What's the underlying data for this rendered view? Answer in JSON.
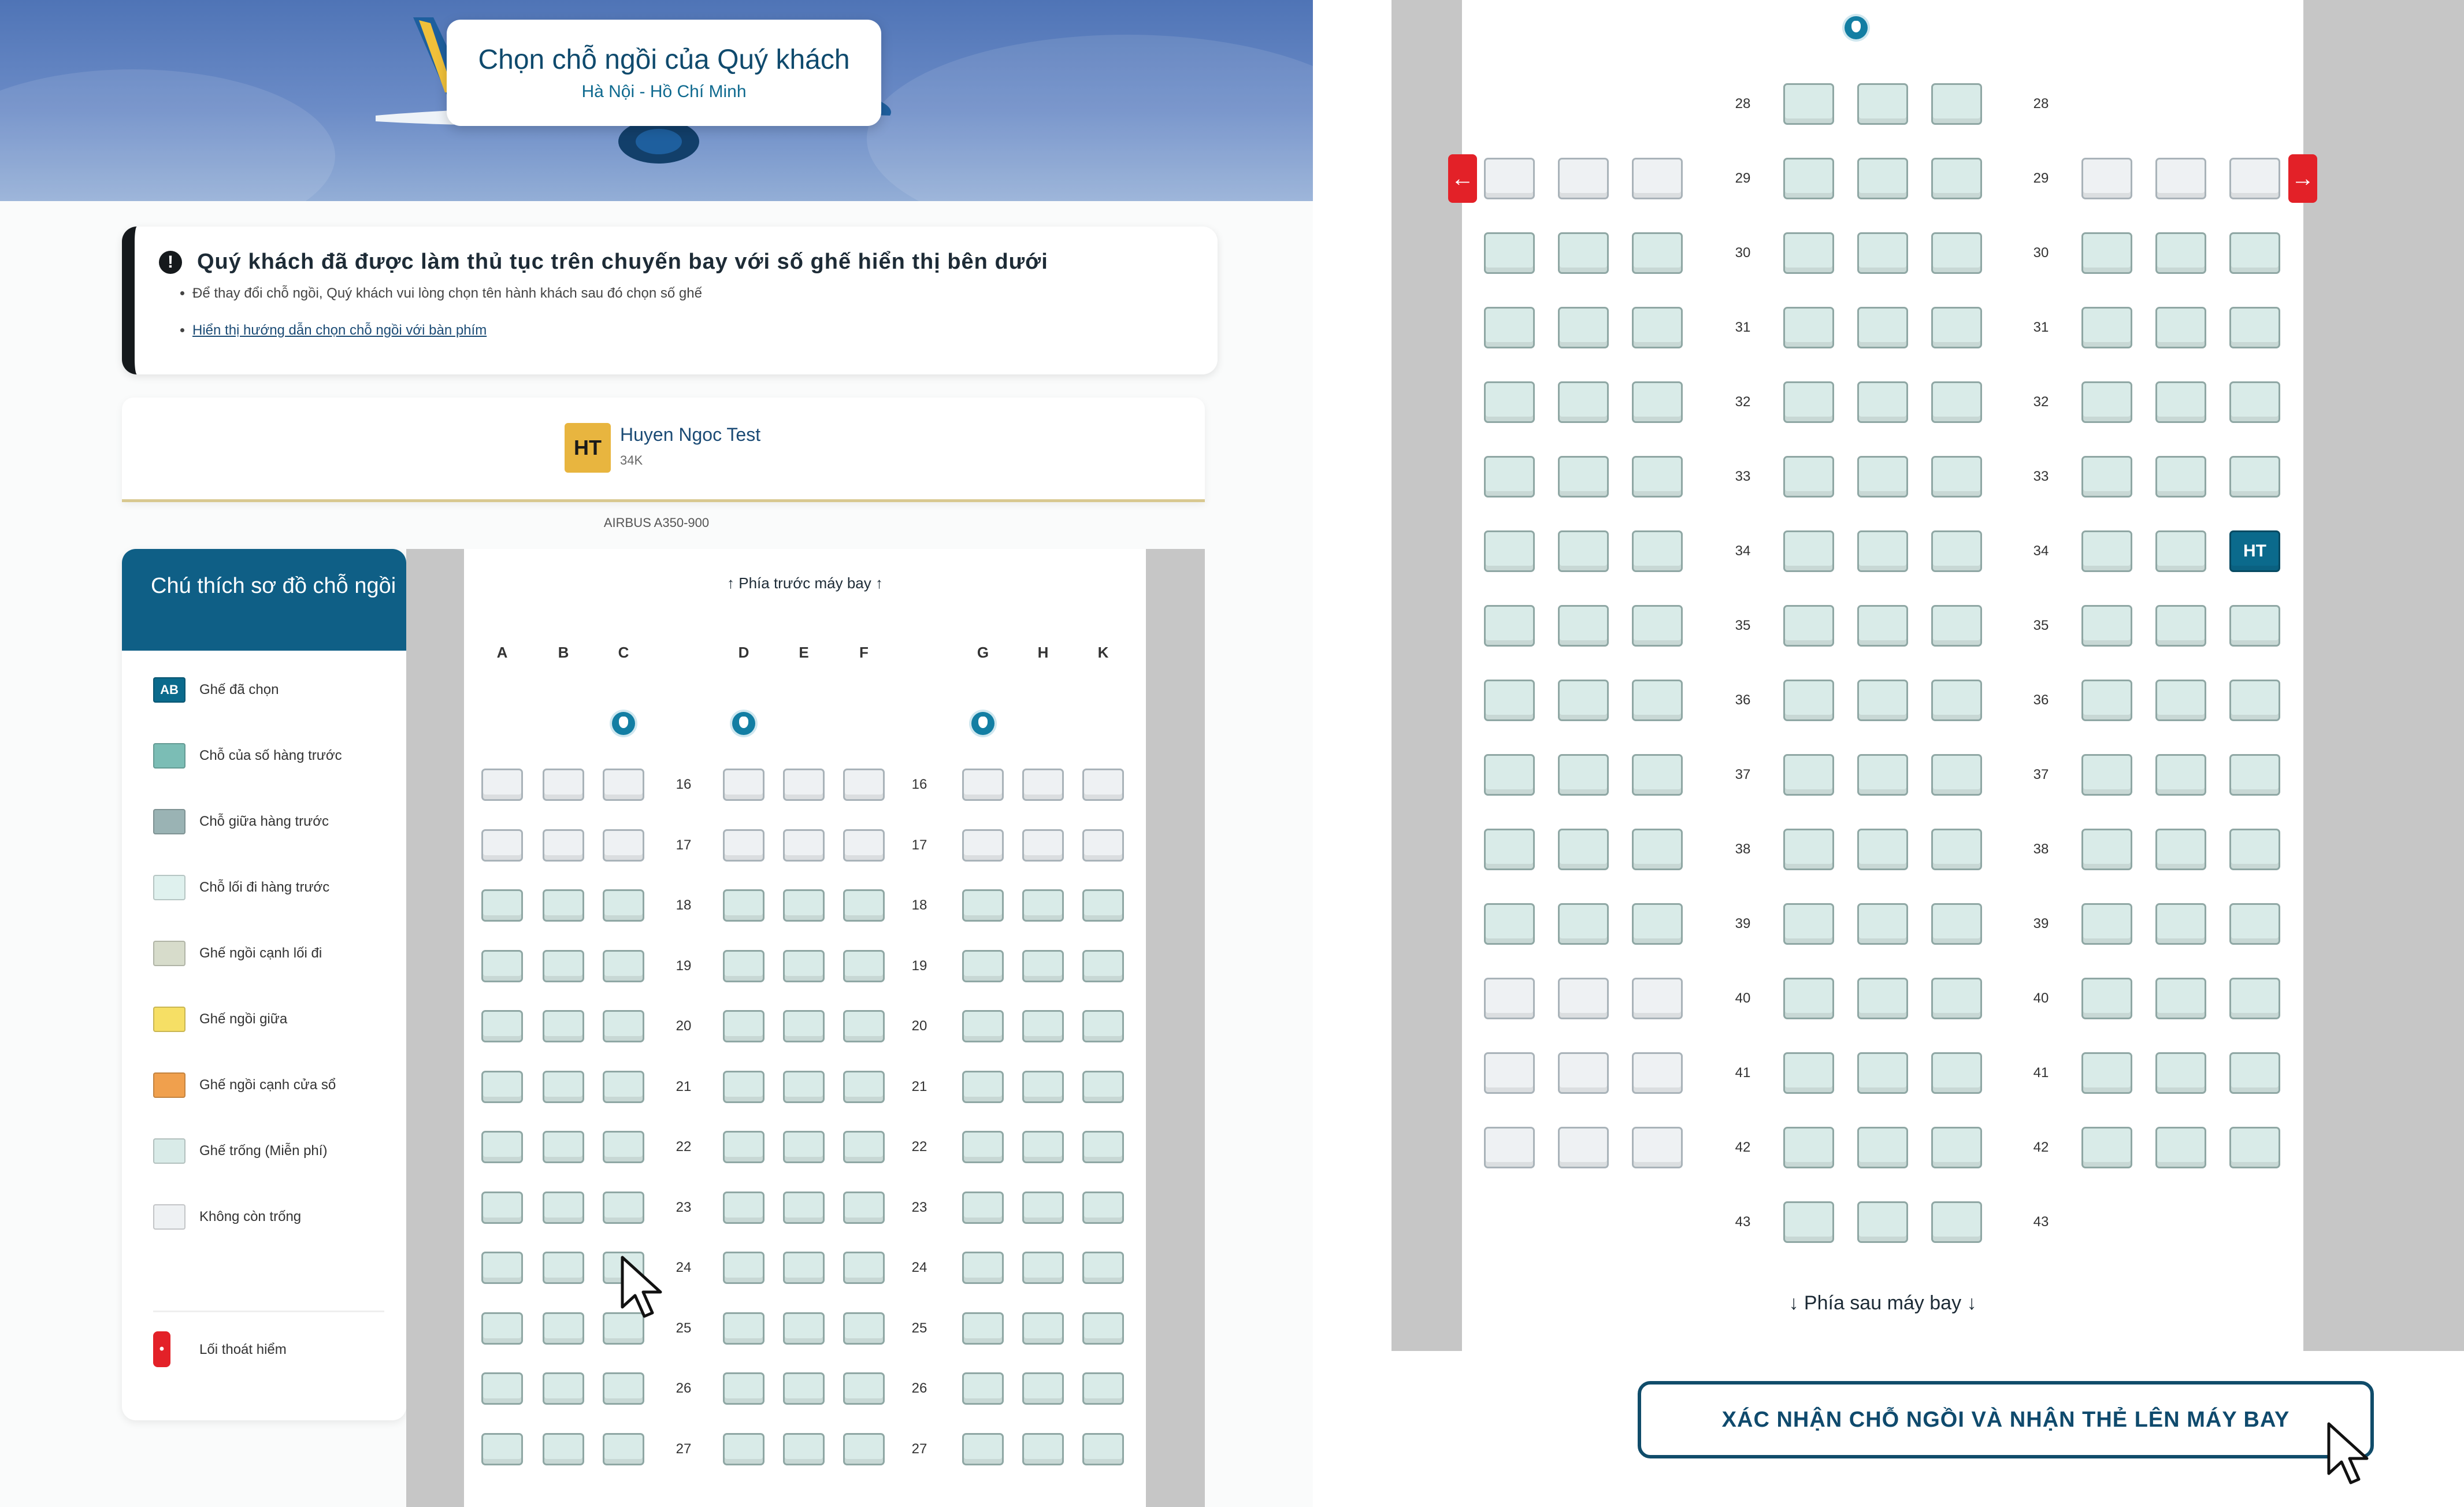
{
  "header": {
    "title": "Chọn chỗ ngồi của Quý khách",
    "route": "Hà Nội - Hồ Chí Minh"
  },
  "notice": {
    "icon": "warning-icon",
    "heading": "Quý khách đã được làm thủ tục trên chuyến bay với số ghế hiển thị bên dưới",
    "bullets": [
      "Để thay đổi chỗ ngồi, Quý khách vui lòng chọn tên hành khách sau đó chọn số ghế",
      "Hiển thị hướng dẫn chọn chỗ ngồi với bàn phím"
    ]
  },
  "passenger": {
    "initials": "HT",
    "name": "Huyen Ngoc Test",
    "seat": "34K"
  },
  "aircraft": "AIRBUS A350-900",
  "legend": {
    "title": "Chú thích sơ đồ chỗ ngồi",
    "items": [
      {
        "swatch": "AB",
        "label": "Ghế đã chọn",
        "color": "#0b6a8c"
      },
      {
        "swatch": "",
        "label": "Chỗ của số hàng trước",
        "color": "#7bbdb5"
      },
      {
        "swatch": "",
        "label": "Chỗ giữa hàng trước",
        "color": "#9ab3b4"
      },
      {
        "swatch": "",
        "label": "Chỗ lối đi hàng trước",
        "color": "#dff1ee"
      },
      {
        "swatch": "",
        "label": "Ghế ngồi cạnh lối đi",
        "color": "#d7dccb"
      },
      {
        "swatch": "",
        "label": "Ghế ngồi giữa",
        "color": "#f6df65"
      },
      {
        "swatch": "",
        "label": "Ghế ngồi cạnh cửa sổ",
        "color": "#f0a04d"
      },
      {
        "swatch": "",
        "label": "Ghế trống (Miễn phí)",
        "color": "#d9ebe8"
      },
      {
        "swatch": "",
        "label": "Không còn trống",
        "color": "#eef1f3"
      }
    ],
    "exit_label": "Lối thoát hiểm"
  },
  "seatmap": {
    "front_label": "Phía trước máy bay",
    "rear_label": "Phía sau máy bay",
    "columns": [
      "A",
      "B",
      "C",
      "D",
      "E",
      "F",
      "G",
      "H",
      "K"
    ],
    "left_rows": [
      "16",
      "17",
      "18",
      "19",
      "20",
      "21",
      "22",
      "23",
      "24",
      "25",
      "26",
      "27"
    ],
    "left_unavailable_rows": [
      "16",
      "17"
    ],
    "right_rows": [
      "28",
      "29",
      "30",
      "31",
      "32",
      "33",
      "34",
      "35",
      "36",
      "37",
      "38",
      "39",
      "40",
      "41",
      "42",
      "43"
    ],
    "right_unavailable": {
      "29": [
        "A",
        "B",
        "C",
        "G",
        "H",
        "K"
      ],
      "40": [
        "A",
        "B",
        "C"
      ],
      "41": [
        "A",
        "B",
        "C"
      ],
      "42": [
        "A",
        "B",
        "C"
      ]
    },
    "selected_seat": {
      "row": "34",
      "col": "K",
      "label": "HT"
    },
    "exit_row": "29"
  },
  "confirm_button": "XÁC NHẬN CHỖ NGỒI VÀ NHẬN THẺ LÊN MÁY BAY",
  "icons": {
    "lavatory": "lavatory-icon",
    "exit_left": "exit-left-arrow-icon",
    "exit_right": "exit-right-arrow-icon",
    "cursor": "mouse-pointer-icon"
  }
}
